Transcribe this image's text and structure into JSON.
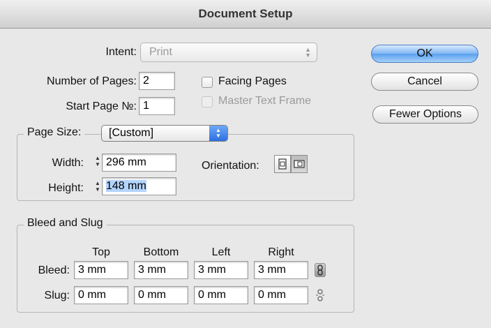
{
  "dialog": {
    "title": "Document Setup"
  },
  "intent": {
    "label": "Intent:",
    "value": "Print"
  },
  "pages": {
    "label": "Number of Pages:",
    "value": "2"
  },
  "start_page": {
    "label": "Start Page №:",
    "value": "1"
  },
  "facing_pages": {
    "label": "Facing Pages",
    "checked": false
  },
  "master_text_frame": {
    "label": "Master Text Frame",
    "checked": false,
    "enabled": false
  },
  "page_size": {
    "label": "Page Size:",
    "value": "[Custom]"
  },
  "width": {
    "label": "Width:",
    "value": "296 mm"
  },
  "height": {
    "label": "Height:",
    "value": "148 mm"
  },
  "orientation": {
    "label": "Orientation:",
    "selected": "landscape"
  },
  "bleed_slug": {
    "legend": "Bleed and Slug",
    "columns": [
      "Top",
      "Bottom",
      "Left",
      "Right"
    ],
    "bleed": {
      "label": "Bleed:",
      "values": [
        "3 mm",
        "3 mm",
        "3 mm",
        "3 mm"
      ]
    },
    "slug": {
      "label": "Slug:",
      "values": [
        "0 mm",
        "0 mm",
        "0 mm",
        "0 mm"
      ]
    }
  },
  "buttons": {
    "ok": "OK",
    "cancel": "Cancel",
    "fewer_options": "Fewer Options"
  },
  "icons": {
    "portrait": "portrait-page-icon",
    "landscape": "landscape-page-icon",
    "link": "link-chain-icon",
    "unlink": "unlink-chain-icon"
  },
  "colors": {
    "accent": "#5aa0ee",
    "selection": "#b3d4fc"
  }
}
